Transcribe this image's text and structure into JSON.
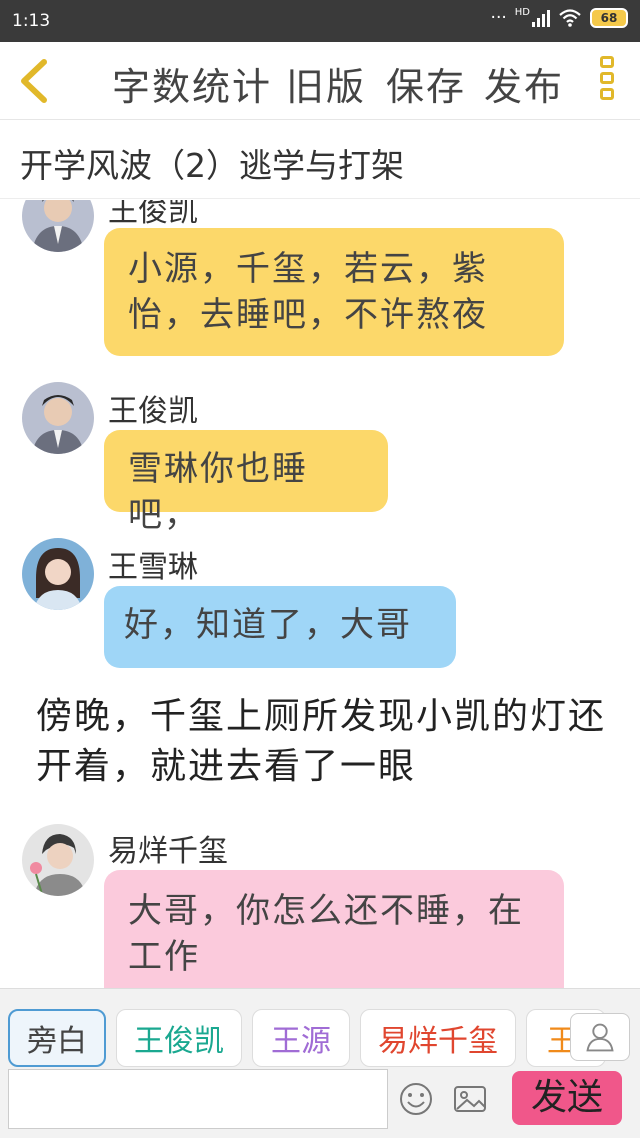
{
  "status": {
    "time": "1:13",
    "network": "HD",
    "battery": "68"
  },
  "toolbar": {
    "word_count": "字数统计",
    "old_version": "旧版",
    "save": "保存",
    "publish": "发布"
  },
  "story": {
    "title": "开学风波（2）逃学与打架"
  },
  "messages": [
    {
      "speaker": "王俊凯",
      "text": "小源，千玺，若云，紫怡，去睡吧，不许熬夜",
      "color": "#fcd86a"
    },
    {
      "speaker": "王俊凯",
      "text": "雪琳你也睡吧，",
      "color": "#fcd86a"
    },
    {
      "speaker": "王雪琳",
      "text": "好，知道了，大哥",
      "color": "#9fd6f7"
    },
    {
      "narration": "傍晚，千玺上厕所发现小凯的灯还开着，就进去看了一眼"
    },
    {
      "speaker": "易烊千玺",
      "text": "大哥，你怎么还不睡，在工作",
      "color": "#fbcadc"
    }
  ],
  "characters": [
    {
      "name": "旁白",
      "color": "#444444"
    },
    {
      "name": "王俊凯",
      "color": "#1aa890"
    },
    {
      "name": "王源",
      "color": "#a06cd5"
    },
    {
      "name": "易烊千玺",
      "color": "#e0462f"
    },
    {
      "name": "王",
      "color": "#f08a1a"
    }
  ],
  "composer": {
    "placeholder": "",
    "send_label": "发送"
  },
  "icons": {
    "back": "chevron-left-icon",
    "menu": "more-icon",
    "add_character": "person-icon",
    "emoji": "smile-icon",
    "image": "image-icon"
  }
}
